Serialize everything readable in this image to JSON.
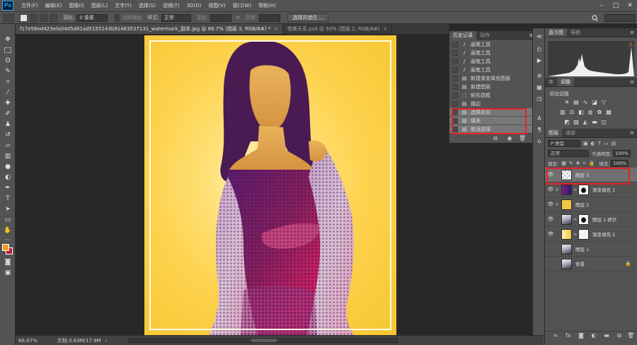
{
  "app": {
    "logo": "Ps"
  },
  "menu": [
    "文件(F)",
    "编辑(E)",
    "图像(I)",
    "图层(L)",
    "文字(Y)",
    "选择(S)",
    "滤镜(T)",
    "3D(D)",
    "视图(V)",
    "窗口(W)",
    "帮助(H)"
  ],
  "window_controls": {
    "minimize": "–",
    "maximize": "□",
    "close": "✕"
  },
  "options": {
    "feather_label": "羽化:",
    "feather_value": "0 像素",
    "antialias_label": "消除锯齿",
    "style_label": "样式:",
    "style_value": "正常",
    "width_label": "宽度:",
    "height_label": "高度:",
    "select_mask_button": "选择并遮住 ..."
  },
  "tabs": [
    {
      "label": "f17e56ed423efa04d5d81ad5155143b91463537131_watermark_副本.jpg @ 66.7% (图层 3, RGB/8#) *",
      "active": true
    },
    {
      "label": "带美天系.psd @ 50% (图层 2, RGB/8#)",
      "active": false
    }
  ],
  "history": {
    "tabs": [
      "历史记录",
      "动作"
    ],
    "menu": "≫ ≡",
    "items": [
      {
        "icon": "brush",
        "label": "画笔工具"
      },
      {
        "icon": "brush",
        "label": "画笔工具"
      },
      {
        "icon": "brush",
        "label": "画笔工具"
      },
      {
        "icon": "brush",
        "label": "画笔工具"
      },
      {
        "icon": "doc",
        "label": "新建渐变填充图层"
      },
      {
        "icon": "doc",
        "label": "新建图层"
      },
      {
        "icon": "marquee",
        "label": "矩形选框"
      },
      {
        "icon": "doc",
        "label": "描边"
      },
      {
        "icon": "doc",
        "label": "选择反向"
      },
      {
        "icon": "doc",
        "label": "填充"
      },
      {
        "icon": "doc",
        "label": "取消选择"
      }
    ]
  },
  "panels": {
    "histogram_tabs": [
      "直方图",
      "导航"
    ],
    "adjust_tabs": [
      "库",
      "调整"
    ],
    "adjust_title": "添加调整",
    "layers_tabs": [
      "图层",
      "通道"
    ],
    "kind_filter": "P 类型",
    "blend_mode": "正常",
    "opacity_label": "不透明度:",
    "opacity_value": "100%",
    "lock_label": "锁定:",
    "fill_label": "填充:",
    "fill_value": "100%"
  },
  "layers": [
    {
      "name": "图层 3",
      "visible": true,
      "selected": true,
      "clip": "",
      "thumb": "transparent",
      "mask": "none"
    },
    {
      "name": "渐变填充 1",
      "visible": true,
      "selected": false,
      "clip": "↓",
      "thumb": "gradient-purple",
      "mask": "figure"
    },
    {
      "name": "图层 2",
      "visible": true,
      "selected": false,
      "clip": "↓",
      "thumb": "yellow",
      "mask": "none"
    },
    {
      "name": "图层 1 拷贝",
      "visible": true,
      "selected": false,
      "clip": "",
      "thumb": "photo",
      "mask": "figure"
    },
    {
      "name": "渐变填充 2",
      "visible": true,
      "selected": false,
      "clip": "",
      "thumb": "gradient-yellow",
      "mask": "white"
    },
    {
      "name": "图层 1",
      "visible": false,
      "selected": false,
      "clip": "",
      "thumb": "photo",
      "mask": "none"
    },
    {
      "name": "背景",
      "visible": false,
      "selected": false,
      "clip": "",
      "thumb": "photo",
      "mask": "none",
      "locked": true
    }
  ],
  "status": {
    "zoom": "66.67%",
    "doc_size": "文档:3.63M/17.9M"
  },
  "colors": {
    "foreground": "#f39d1e",
    "background": "#c0152d",
    "highlight": "#e5202a"
  }
}
